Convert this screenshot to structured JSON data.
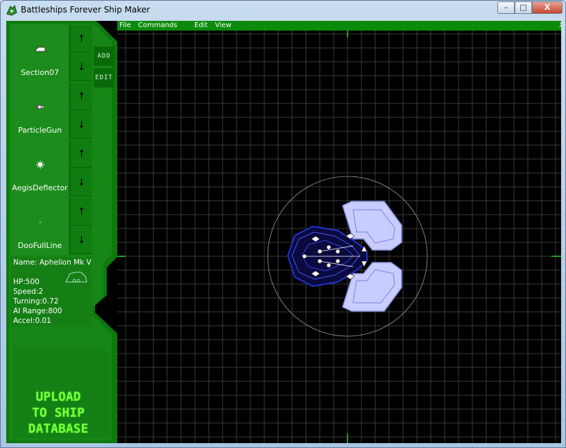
{
  "window": {
    "title": "Battleships Forever Ship Maker",
    "controls": {
      "minimize": "–",
      "maximize": "□",
      "close": "X"
    }
  },
  "menubar": {
    "items": [
      "File",
      "Commands",
      "Edit",
      "View"
    ],
    "close_label": "X"
  },
  "parts_panel": {
    "items": [
      {
        "label": "Section07",
        "icon": "hull-section-icon"
      },
      {
        "label": "ParticleGun",
        "icon": "particle-gun-icon"
      },
      {
        "label": "AegisDeflector",
        "icon": "aegis-deflector-icon"
      },
      {
        "label": "DooFullLine",
        "icon": "doo-line-icon",
        "glyph": "-"
      }
    ],
    "up_arrow": "↑",
    "down_arrow": "↓"
  },
  "side_tabs": {
    "add": "ADD",
    "edit": "EDIT"
  },
  "ship_stats": {
    "name": "Name:  Aphelion Mk V",
    "hp": "HP:500",
    "speed": "Speed:2",
    "turning": "Turning:0.72",
    "ai_range": "AI Range:800",
    "accel": "Accel:0.01"
  },
  "upload_button": {
    "lines": [
      "UPLOAD",
      "TO SHIP",
      "DATABASE"
    ]
  },
  "colors": {
    "panel_green": "#1c8c1c",
    "menubar_green": "#0c8a0c",
    "upload_text": "#7cff3a",
    "grid_line": "#3a3a3a",
    "ship_blue": "#2233cc",
    "ship_pale": "#aab4ff"
  }
}
